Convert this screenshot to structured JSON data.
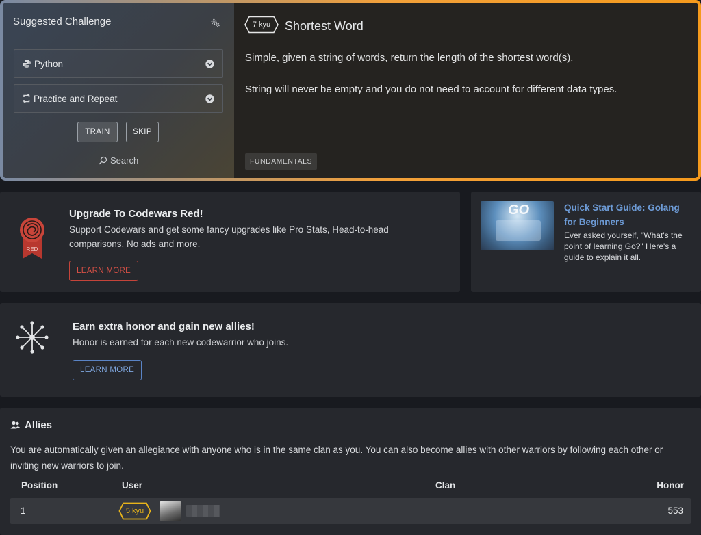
{
  "suggested": {
    "title": "Suggested Challenge",
    "language": "Python",
    "strategy": "Practice and Repeat",
    "train_label": "TRAIN",
    "skip_label": "SKIP",
    "search_label": "Search"
  },
  "kata": {
    "rank": "7 kyu",
    "name": "Shortest Word",
    "description": [
      "Simple, given a string of words, return the length of the shortest word(s).",
      "String will never be empty and you do not need to account for different data types."
    ],
    "tag": "FUNDAMENTALS"
  },
  "upgrade": {
    "badge_text": "RED",
    "title": "Upgrade To Codewars Red!",
    "text": "Support Codewars and get some fancy upgrades like Pro Stats, Head-to-head comparisons, No ads and more.",
    "button": "LEARN MORE"
  },
  "guide": {
    "thumb_text": "GO",
    "title": "Quick Start Guide: Golang for Beginners",
    "text": "Ever asked yourself, \"What's the point of learning Go?\" Here's a guide to explain it all."
  },
  "honor": {
    "title": "Earn extra honor and gain new allies!",
    "text": "Honor is earned for each new codewarrior who joins.",
    "button": "LEARN MORE"
  },
  "allies": {
    "title": "Allies",
    "text": "You are automatically given an allegiance with anyone who is in the same clan as you. You can also become allies with other warriors by following each other or inviting new warriors to join.",
    "columns": [
      "Position",
      "User",
      "Clan",
      "Honor"
    ],
    "rows": [
      {
        "position": "1",
        "rank": "5 kyu",
        "clan": "",
        "honor": "553"
      }
    ]
  },
  "colors": {
    "accent_orange": "#f59a1c",
    "red": "#c5443a",
    "blue": "#5a84c6",
    "rank_yellow": "#e8b41a"
  }
}
